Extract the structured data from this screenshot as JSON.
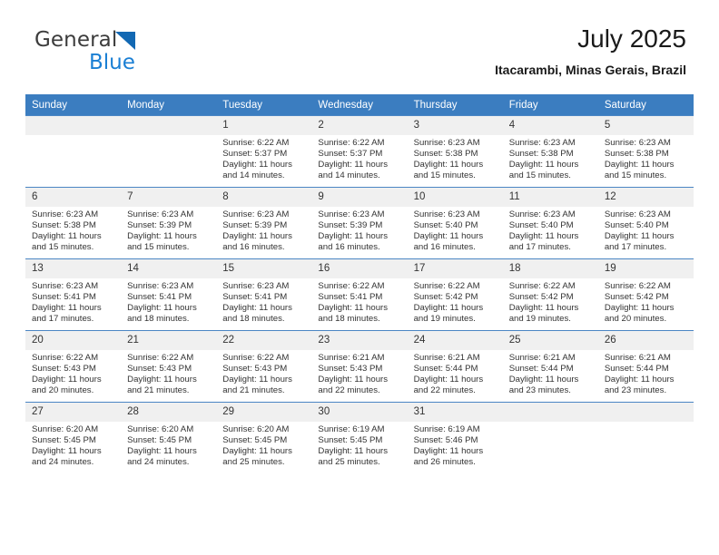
{
  "brand": {
    "name_part1": "General",
    "name_part2": "Blue",
    "triangle_icon": "triangle-icon"
  },
  "header": {
    "title": "July 2025",
    "location": "Itacarambi, Minas Gerais, Brazil"
  },
  "colors": {
    "header_blue": "#3b7dc0",
    "daynum_gray": "#f0f0f0",
    "logo_blue": "#1a7fd4",
    "text": "#333333"
  },
  "weekday_headers": [
    "Sunday",
    "Monday",
    "Tuesday",
    "Wednesday",
    "Thursday",
    "Friday",
    "Saturday"
  ],
  "labels": {
    "sunrise_prefix": "Sunrise: ",
    "sunset_prefix": "Sunset: ",
    "daylight_prefix": "Daylight: "
  },
  "weeks": [
    [
      {
        "day": "",
        "blank": true,
        "sunrise": "",
        "sunset": "",
        "daylight_line1": "",
        "daylight_line2": ""
      },
      {
        "day": "",
        "blank": true,
        "sunrise": "",
        "sunset": "",
        "daylight_line1": "",
        "daylight_line2": ""
      },
      {
        "day": "1",
        "sunrise": "Sunrise: 6:22 AM",
        "sunset": "Sunset: 5:37 PM",
        "daylight_line1": "Daylight: 11 hours",
        "daylight_line2": "and 14 minutes."
      },
      {
        "day": "2",
        "sunrise": "Sunrise: 6:22 AM",
        "sunset": "Sunset: 5:37 PM",
        "daylight_line1": "Daylight: 11 hours",
        "daylight_line2": "and 14 minutes."
      },
      {
        "day": "3",
        "sunrise": "Sunrise: 6:23 AM",
        "sunset": "Sunset: 5:38 PM",
        "daylight_line1": "Daylight: 11 hours",
        "daylight_line2": "and 15 minutes."
      },
      {
        "day": "4",
        "sunrise": "Sunrise: 6:23 AM",
        "sunset": "Sunset: 5:38 PM",
        "daylight_line1": "Daylight: 11 hours",
        "daylight_line2": "and 15 minutes."
      },
      {
        "day": "5",
        "sunrise": "Sunrise: 6:23 AM",
        "sunset": "Sunset: 5:38 PM",
        "daylight_line1": "Daylight: 11 hours",
        "daylight_line2": "and 15 minutes."
      }
    ],
    [
      {
        "day": "6",
        "sunrise": "Sunrise: 6:23 AM",
        "sunset": "Sunset: 5:38 PM",
        "daylight_line1": "Daylight: 11 hours",
        "daylight_line2": "and 15 minutes."
      },
      {
        "day": "7",
        "sunrise": "Sunrise: 6:23 AM",
        "sunset": "Sunset: 5:39 PM",
        "daylight_line1": "Daylight: 11 hours",
        "daylight_line2": "and 15 minutes."
      },
      {
        "day": "8",
        "sunrise": "Sunrise: 6:23 AM",
        "sunset": "Sunset: 5:39 PM",
        "daylight_line1": "Daylight: 11 hours",
        "daylight_line2": "and 16 minutes."
      },
      {
        "day": "9",
        "sunrise": "Sunrise: 6:23 AM",
        "sunset": "Sunset: 5:39 PM",
        "daylight_line1": "Daylight: 11 hours",
        "daylight_line2": "and 16 minutes."
      },
      {
        "day": "10",
        "sunrise": "Sunrise: 6:23 AM",
        "sunset": "Sunset: 5:40 PM",
        "daylight_line1": "Daylight: 11 hours",
        "daylight_line2": "and 16 minutes."
      },
      {
        "day": "11",
        "sunrise": "Sunrise: 6:23 AM",
        "sunset": "Sunset: 5:40 PM",
        "daylight_line1": "Daylight: 11 hours",
        "daylight_line2": "and 17 minutes."
      },
      {
        "day": "12",
        "sunrise": "Sunrise: 6:23 AM",
        "sunset": "Sunset: 5:40 PM",
        "daylight_line1": "Daylight: 11 hours",
        "daylight_line2": "and 17 minutes."
      }
    ],
    [
      {
        "day": "13",
        "sunrise": "Sunrise: 6:23 AM",
        "sunset": "Sunset: 5:41 PM",
        "daylight_line1": "Daylight: 11 hours",
        "daylight_line2": "and 17 minutes."
      },
      {
        "day": "14",
        "sunrise": "Sunrise: 6:23 AM",
        "sunset": "Sunset: 5:41 PM",
        "daylight_line1": "Daylight: 11 hours",
        "daylight_line2": "and 18 minutes."
      },
      {
        "day": "15",
        "sunrise": "Sunrise: 6:23 AM",
        "sunset": "Sunset: 5:41 PM",
        "daylight_line1": "Daylight: 11 hours",
        "daylight_line2": "and 18 minutes."
      },
      {
        "day": "16",
        "sunrise": "Sunrise: 6:22 AM",
        "sunset": "Sunset: 5:41 PM",
        "daylight_line1": "Daylight: 11 hours",
        "daylight_line2": "and 18 minutes."
      },
      {
        "day": "17",
        "sunrise": "Sunrise: 6:22 AM",
        "sunset": "Sunset: 5:42 PM",
        "daylight_line1": "Daylight: 11 hours",
        "daylight_line2": "and 19 minutes."
      },
      {
        "day": "18",
        "sunrise": "Sunrise: 6:22 AM",
        "sunset": "Sunset: 5:42 PM",
        "daylight_line1": "Daylight: 11 hours",
        "daylight_line2": "and 19 minutes."
      },
      {
        "day": "19",
        "sunrise": "Sunrise: 6:22 AM",
        "sunset": "Sunset: 5:42 PM",
        "daylight_line1": "Daylight: 11 hours",
        "daylight_line2": "and 20 minutes."
      }
    ],
    [
      {
        "day": "20",
        "sunrise": "Sunrise: 6:22 AM",
        "sunset": "Sunset: 5:43 PM",
        "daylight_line1": "Daylight: 11 hours",
        "daylight_line2": "and 20 minutes."
      },
      {
        "day": "21",
        "sunrise": "Sunrise: 6:22 AM",
        "sunset": "Sunset: 5:43 PM",
        "daylight_line1": "Daylight: 11 hours",
        "daylight_line2": "and 21 minutes."
      },
      {
        "day": "22",
        "sunrise": "Sunrise: 6:22 AM",
        "sunset": "Sunset: 5:43 PM",
        "daylight_line1": "Daylight: 11 hours",
        "daylight_line2": "and 21 minutes."
      },
      {
        "day": "23",
        "sunrise": "Sunrise: 6:21 AM",
        "sunset": "Sunset: 5:43 PM",
        "daylight_line1": "Daylight: 11 hours",
        "daylight_line2": "and 22 minutes."
      },
      {
        "day": "24",
        "sunrise": "Sunrise: 6:21 AM",
        "sunset": "Sunset: 5:44 PM",
        "daylight_line1": "Daylight: 11 hours",
        "daylight_line2": "and 22 minutes."
      },
      {
        "day": "25",
        "sunrise": "Sunrise: 6:21 AM",
        "sunset": "Sunset: 5:44 PM",
        "daylight_line1": "Daylight: 11 hours",
        "daylight_line2": "and 23 minutes."
      },
      {
        "day": "26",
        "sunrise": "Sunrise: 6:21 AM",
        "sunset": "Sunset: 5:44 PM",
        "daylight_line1": "Daylight: 11 hours",
        "daylight_line2": "and 23 minutes."
      }
    ],
    [
      {
        "day": "27",
        "sunrise": "Sunrise: 6:20 AM",
        "sunset": "Sunset: 5:45 PM",
        "daylight_line1": "Daylight: 11 hours",
        "daylight_line2": "and 24 minutes."
      },
      {
        "day": "28",
        "sunrise": "Sunrise: 6:20 AM",
        "sunset": "Sunset: 5:45 PM",
        "daylight_line1": "Daylight: 11 hours",
        "daylight_line2": "and 24 minutes."
      },
      {
        "day": "29",
        "sunrise": "Sunrise: 6:20 AM",
        "sunset": "Sunset: 5:45 PM",
        "daylight_line1": "Daylight: 11 hours",
        "daylight_line2": "and 25 minutes."
      },
      {
        "day": "30",
        "sunrise": "Sunrise: 6:19 AM",
        "sunset": "Sunset: 5:45 PM",
        "daylight_line1": "Daylight: 11 hours",
        "daylight_line2": "and 25 minutes."
      },
      {
        "day": "31",
        "sunrise": "Sunrise: 6:19 AM",
        "sunset": "Sunset: 5:46 PM",
        "daylight_line1": "Daylight: 11 hours",
        "daylight_line2": "and 26 minutes."
      },
      {
        "day": "",
        "blank": true,
        "sunrise": "",
        "sunset": "",
        "daylight_line1": "",
        "daylight_line2": ""
      },
      {
        "day": "",
        "blank": true,
        "sunrise": "",
        "sunset": "",
        "daylight_line1": "",
        "daylight_line2": ""
      }
    ]
  ]
}
